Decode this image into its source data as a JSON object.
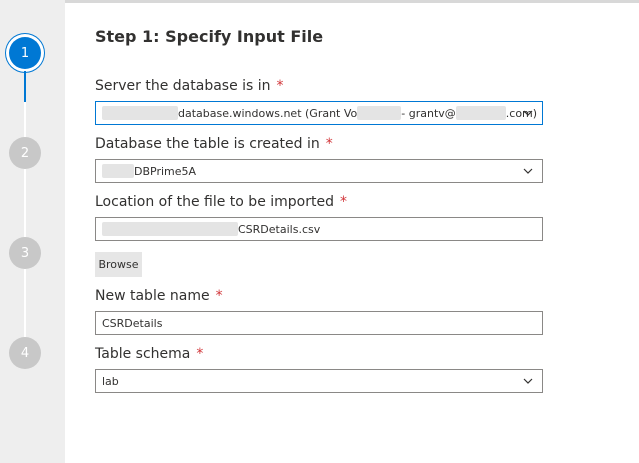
{
  "steps": [
    {
      "number": "1",
      "active": true
    },
    {
      "number": "2",
      "active": false
    },
    {
      "number": "3",
      "active": false
    },
    {
      "number": "4",
      "active": false
    }
  ],
  "title": "Step 1: Specify Input File",
  "server": {
    "label": "Server the database is in",
    "required_mark": "*",
    "value_visible_1": "database.windows.net (Grant Vo",
    "value_visible_2": "- grantv@",
    "value_visible_3": ".com)"
  },
  "database": {
    "label": "Database the table is created in",
    "required_mark": "*",
    "value_visible": "DBPrime5A"
  },
  "file": {
    "label": "Location of the file to be imported",
    "required_mark": "*",
    "value_visible": "CSRDetails.csv"
  },
  "browse_label": "Browse",
  "table_name": {
    "label": "New table name",
    "required_mark": "*",
    "value": "CSRDetails"
  },
  "schema": {
    "label": "Table schema",
    "required_mark": "*",
    "value": "lab"
  },
  "icons": {
    "dropdown": "chevron-down-icon"
  },
  "colors": {
    "accent": "#0078d4",
    "required": "#d13438",
    "sidebar": "#eeeeee",
    "step_inactive": "#c8c8c8"
  }
}
